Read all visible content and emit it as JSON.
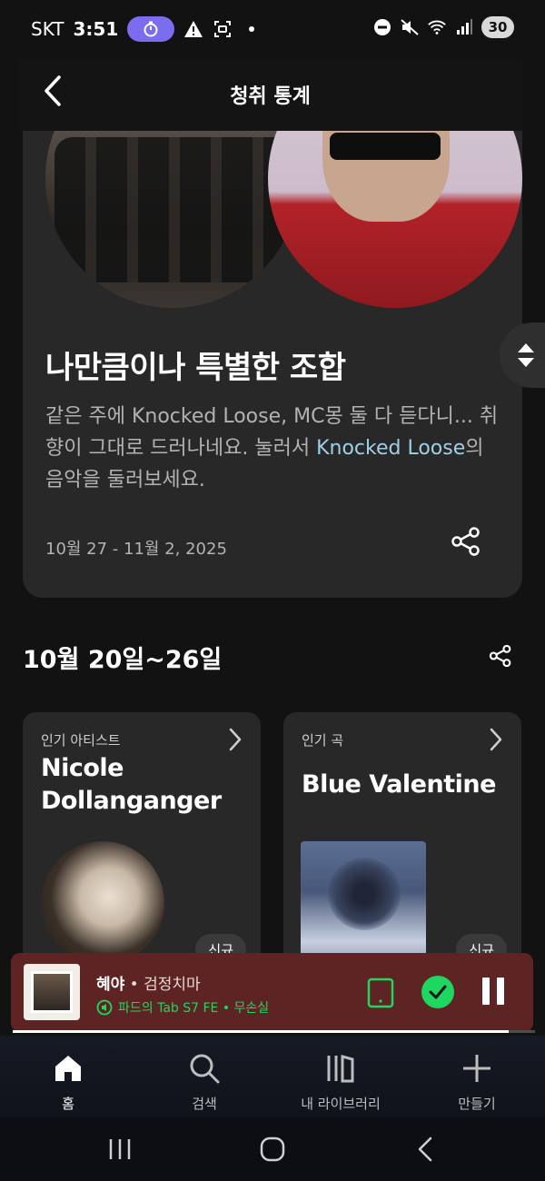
{
  "status_bar": {
    "carrier": "SKT",
    "time": "3:51",
    "battery": "30"
  },
  "header": {
    "title": "청취 통계"
  },
  "feature_card": {
    "title": "나만큼이나 특별한 조합",
    "desc_part1": "같은 주에 Knocked Loose, MC몽 둘 다 듣다니... 취향이 그대로 드러나네요. 눌러서 ",
    "desc_link": "Knocked Loose",
    "desc_part2": "의 음악을 둘러보세요.",
    "date_range": "10월 27 - 11월 2, 2025"
  },
  "week_section": {
    "title": "10월 20일~26일",
    "tiles": [
      {
        "label": "인기 아티스트",
        "name": "Nicole Dollanganger",
        "badge": "신규"
      },
      {
        "label": "인기 곡",
        "name": "Blue Valentine",
        "badge": "신규"
      }
    ]
  },
  "player": {
    "track": "혜야",
    "separator": " • ",
    "artist": "검정치마",
    "device": "파드의 Tab S7 FE • 무손실",
    "progress": 0.95,
    "colors": {
      "background": "#5e2423",
      "accent": "#1ed760"
    }
  },
  "bottom_nav": {
    "items": [
      {
        "label": "홈",
        "icon": "home-icon",
        "active": true
      },
      {
        "label": "검색",
        "icon": "search-icon",
        "active": false
      },
      {
        "label": "내 라이브러리",
        "icon": "library-icon",
        "active": false
      },
      {
        "label": "만들기",
        "icon": "plus-icon",
        "active": false
      }
    ]
  }
}
